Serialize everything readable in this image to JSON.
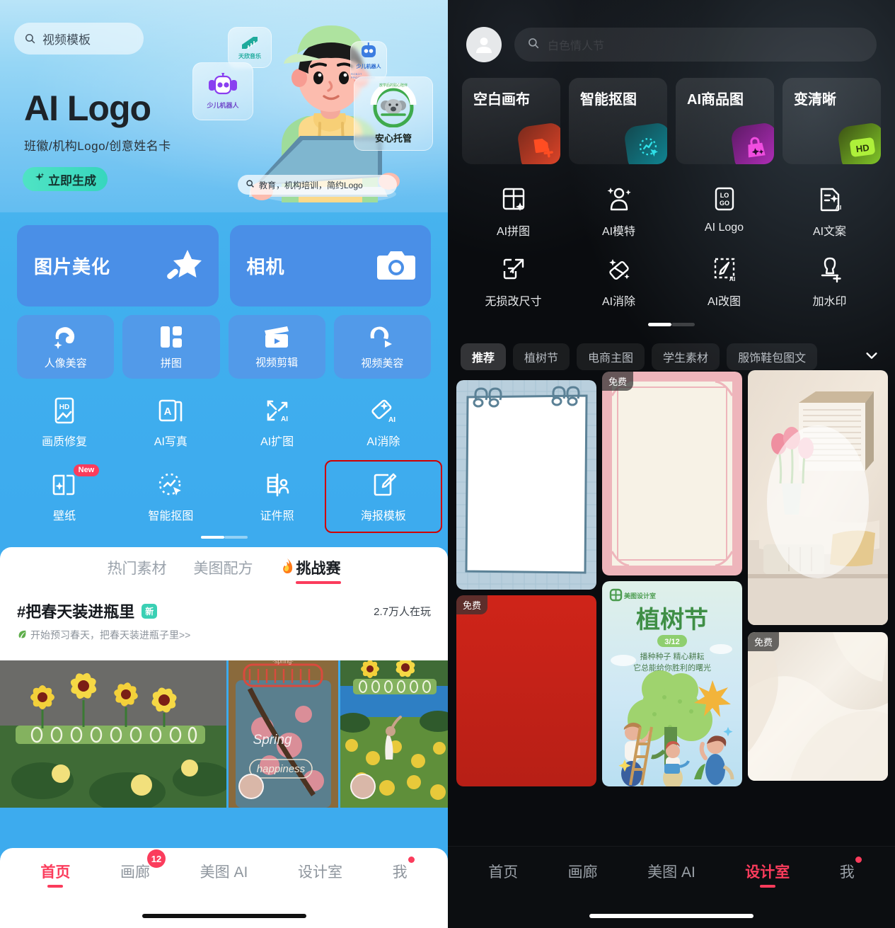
{
  "left": {
    "search": {
      "value": "视频模板",
      "icon": "search-icon"
    },
    "hero": {
      "title": "AI Logo",
      "subtitle": "班徽/机构Logo/创意姓名卡",
      "cta": "立即生成",
      "cta_icon": "sparkle-icon",
      "inner_search": "教育，机构培训，简约Logo",
      "cards": [
        {
          "label": "天欣音乐",
          "icon": "piano-icon"
        },
        {
          "label": "少儿机器人",
          "icon": "robot-icon"
        },
        {
          "label": "少儿机器人",
          "sub": "ROBOT PROGRAMMING",
          "icon": "robot-head-icon"
        },
        {
          "label": "安心托管",
          "sub": "放学后的贴心陪伴",
          "icon": "koala-icon"
        }
      ]
    },
    "big_tiles": [
      {
        "label": "图片美化",
        "icon": "magic-wand-icon"
      },
      {
        "label": "相机",
        "icon": "camera-icon"
      }
    ],
    "small_tiles": [
      {
        "label": "人像美容",
        "icon": "portrait-icon"
      },
      {
        "label": "拼图",
        "icon": "collage-icon"
      },
      {
        "label": "视频剪辑",
        "icon": "clapperboard-icon"
      },
      {
        "label": "视频美容",
        "icon": "video-beauty-icon"
      }
    ],
    "tools": [
      {
        "label": "画质修复",
        "icon": "hd-image-icon"
      },
      {
        "label": "AI写真",
        "icon": "ai-portrait-icon"
      },
      {
        "label": "AI扩图",
        "icon": "ai-expand-icon"
      },
      {
        "label": "AI消除",
        "icon": "ai-eraser-icon"
      },
      {
        "label": "壁纸",
        "icon": "wallpaper-icon",
        "badge": "New"
      },
      {
        "label": "智能抠图",
        "icon": "smart-cutout-icon"
      },
      {
        "label": "证件照",
        "icon": "id-photo-icon"
      },
      {
        "label": "海报模板",
        "icon": "poster-template-icon",
        "highlighted": true
      }
    ],
    "sheet_tabs": [
      {
        "label": "热门素材",
        "active": false
      },
      {
        "label": "美图配方",
        "active": false
      },
      {
        "label": "挑战赛",
        "active": true,
        "icon": "fire-icon"
      }
    ],
    "challenge": {
      "title": "#把春天装进瓶里",
      "badge": "新",
      "count": "2.7万人在玩",
      "desc": "开始预习春天，把春天装进瓶子里>>",
      "desc_icon": "leaf-icon"
    },
    "nav": [
      {
        "label": "首页",
        "active": true
      },
      {
        "label": "画廊",
        "active": false,
        "badge": "12"
      },
      {
        "label": "美图 AI",
        "active": false
      },
      {
        "label": "设计室",
        "active": false
      },
      {
        "label": "我",
        "active": false,
        "dot": true
      }
    ]
  },
  "right": {
    "avatar_icon": "user-avatar-icon",
    "search": {
      "placeholder": "白色情人节",
      "icon": "search-icon"
    },
    "quick_cards": [
      {
        "label": "空白画布",
        "icon": "blank-canvas-icon",
        "color": "#e8472a"
      },
      {
        "label": "智能抠图",
        "icon": "smart-cutout-icon",
        "color": "#13a6b5"
      },
      {
        "label": "AI商品图",
        "icon": "ai-product-icon",
        "color": "#d93ad0"
      },
      {
        "label": "变清晰",
        "icon": "hd-enhance-icon",
        "color": "#a4e82a"
      }
    ],
    "tools": [
      {
        "label": "AI拼图",
        "icon": "ai-collage-icon"
      },
      {
        "label": "AI模特",
        "icon": "ai-model-icon"
      },
      {
        "label": "AI Logo",
        "icon": "ai-logo-icon"
      },
      {
        "label": "AI文案",
        "icon": "ai-copywriting-icon"
      },
      {
        "label": "无损改尺寸",
        "icon": "lossless-resize-icon"
      },
      {
        "label": "AI消除",
        "icon": "ai-eraser-icon"
      },
      {
        "label": "AI改图",
        "icon": "ai-edit-icon"
      },
      {
        "label": "加水印",
        "icon": "watermark-icon"
      }
    ],
    "chips": [
      {
        "label": "推荐",
        "active": true
      },
      {
        "label": "植树节",
        "active": false
      },
      {
        "label": "电商主图",
        "active": false
      },
      {
        "label": "学生素材",
        "active": false
      },
      {
        "label": "服饰鞋包图文",
        "active": false
      }
    ],
    "chip_expand_icon": "chevron-down-icon",
    "templates": [
      {
        "name": "notepad-template",
        "free_label": ""
      },
      {
        "name": "pink-frame-template",
        "free_label": "免费"
      },
      {
        "name": "tulip-photo-template",
        "free_label": ""
      },
      {
        "name": "red-poster-template",
        "free_label": "免费"
      },
      {
        "name": "arbor-day-template",
        "free_label": "",
        "brand": "美图设计室",
        "title": "植树节",
        "date": "3/12",
        "line1": "播种种子 精心耕耘",
        "line2": "它总能给你胜利的曙光"
      },
      {
        "name": "white-fabric-template",
        "free_label": "免费"
      }
    ],
    "nav": [
      {
        "label": "首页",
        "active": false
      },
      {
        "label": "画廊",
        "active": false
      },
      {
        "label": "美图 AI",
        "active": false
      },
      {
        "label": "设计室",
        "active": true
      },
      {
        "label": "我",
        "active": false,
        "dot": true
      }
    ]
  }
}
